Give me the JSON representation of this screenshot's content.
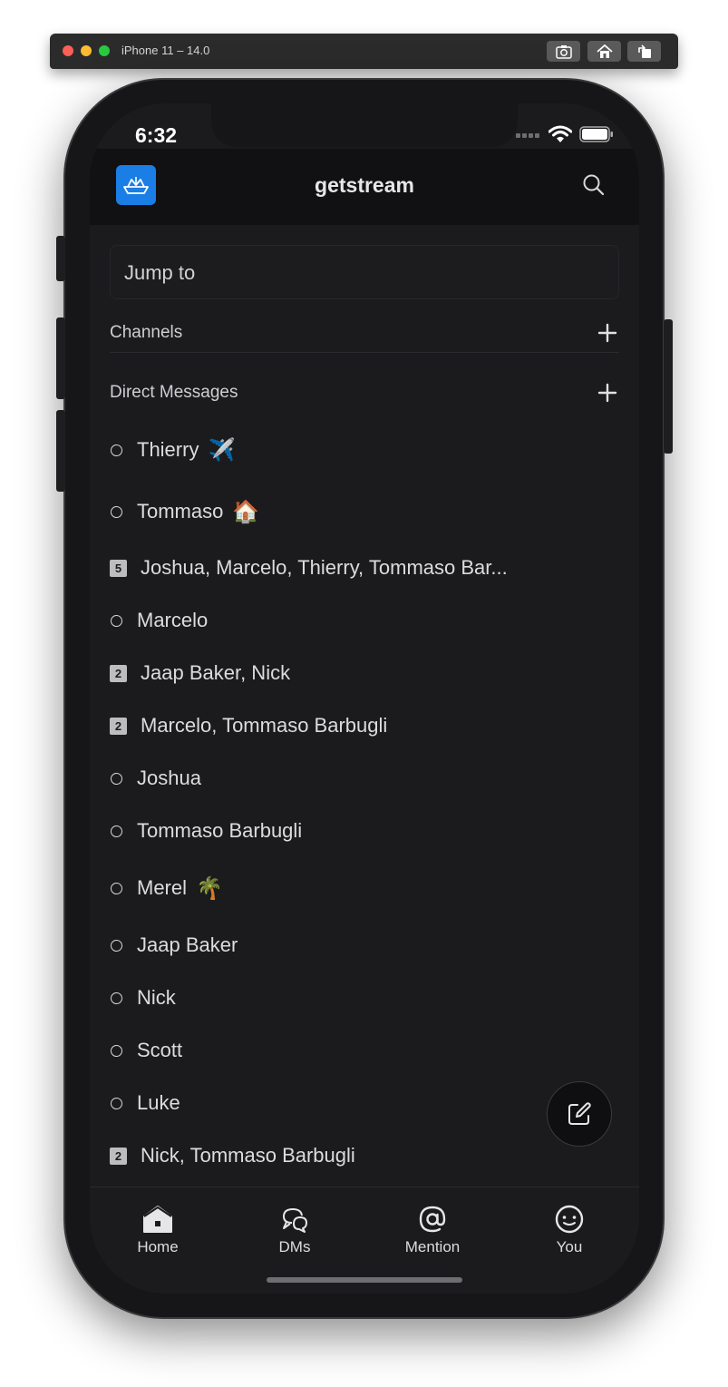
{
  "simulator": {
    "title": "iPhone 11 – 14.0",
    "buttons": [
      "screenshot-icon",
      "home-icon",
      "rotate-icon"
    ]
  },
  "status_bar": {
    "time": "6:32"
  },
  "header": {
    "title": "getstream",
    "logo_icon": "stream-boat-logo",
    "search_icon": "search-icon"
  },
  "jump_to": {
    "placeholder": "Jump to"
  },
  "sections": {
    "channels": {
      "label": "Channels",
      "add_icon": "plus-icon"
    },
    "direct_messages": {
      "label": "Direct Messages",
      "add_icon": "plus-icon"
    }
  },
  "dms": [
    {
      "type": "user",
      "label": "Thierry",
      "emoji": "✈️"
    },
    {
      "type": "user",
      "label": "Tommaso",
      "emoji": "🏠"
    },
    {
      "type": "group",
      "count": "5",
      "label": "Joshua, Marcelo, Thierry, Tommaso Bar..."
    },
    {
      "type": "user",
      "label": "Marcelo"
    },
    {
      "type": "group",
      "count": "2",
      "label": "Jaap Baker, Nick"
    },
    {
      "type": "group",
      "count": "2",
      "label": "Marcelo, Tommaso Barbugli"
    },
    {
      "type": "user",
      "label": "Joshua"
    },
    {
      "type": "user",
      "label": "Tommaso Barbugli"
    },
    {
      "type": "user",
      "label": "Merel",
      "emoji": "🌴"
    },
    {
      "type": "user",
      "label": "Jaap Baker"
    },
    {
      "type": "user",
      "label": "Nick"
    },
    {
      "type": "user",
      "label": "Scott"
    },
    {
      "type": "user",
      "label": "Luke"
    },
    {
      "type": "group",
      "count": "2",
      "label": "Nick, Tommaso Barbugli"
    }
  ],
  "tabs": [
    {
      "label": "Home",
      "icon": "home-icon"
    },
    {
      "label": "DMs",
      "icon": "chat-bubbles-icon"
    },
    {
      "label": "Mention",
      "icon": "at-icon"
    },
    {
      "label": "You",
      "icon": "smiley-icon"
    }
  ],
  "colors": {
    "background": "#1b1b1e",
    "header": "#111113",
    "accent": "#1a7ee6",
    "text": "#dcdcde"
  }
}
